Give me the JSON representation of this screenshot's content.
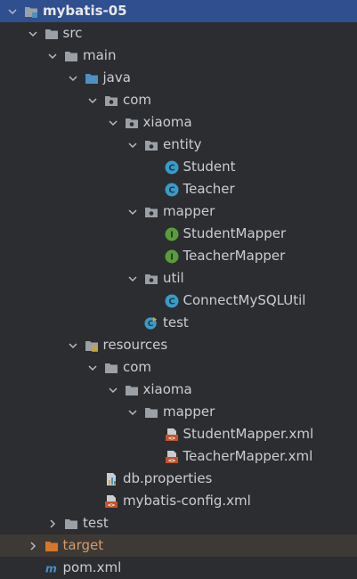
{
  "tree": [
    {
      "label": "mybatis-05",
      "kind": "module-folder",
      "icon": "module-folder-icon",
      "depth": 0,
      "expanded": true,
      "selected": true,
      "bold": true
    },
    {
      "label": "src",
      "kind": "folder",
      "icon": "folder-icon",
      "depth": 1,
      "expanded": true
    },
    {
      "label": "main",
      "kind": "folder",
      "icon": "folder-icon",
      "depth": 2,
      "expanded": true
    },
    {
      "label": "java",
      "kind": "source-folder",
      "icon": "source-root-folder-icon",
      "depth": 3,
      "expanded": true
    },
    {
      "label": "com",
      "kind": "package",
      "icon": "package-icon",
      "depth": 4,
      "expanded": true
    },
    {
      "label": "xiaoma",
      "kind": "package",
      "icon": "package-icon",
      "depth": 5,
      "expanded": true
    },
    {
      "label": "entity",
      "kind": "package",
      "icon": "package-icon",
      "depth": 6,
      "expanded": true
    },
    {
      "label": "Student",
      "kind": "class",
      "icon": "class-icon",
      "depth": 7
    },
    {
      "label": "Teacher",
      "kind": "class",
      "icon": "class-icon",
      "depth": 7
    },
    {
      "label": "mapper",
      "kind": "package",
      "icon": "package-icon",
      "depth": 6,
      "expanded": true
    },
    {
      "label": "StudentMapper",
      "kind": "interface",
      "icon": "interface-icon",
      "depth": 7
    },
    {
      "label": "TeacherMapper",
      "kind": "interface",
      "icon": "interface-icon",
      "depth": 7
    },
    {
      "label": "util",
      "kind": "package",
      "icon": "package-icon",
      "depth": 6,
      "expanded": true
    },
    {
      "label": "ConnectMySQLUtil",
      "kind": "class",
      "icon": "class-icon",
      "depth": 7
    },
    {
      "label": "test",
      "kind": "runnable-class",
      "icon": "runnable-class-icon",
      "depth": 6
    },
    {
      "label": "resources",
      "kind": "resources-folder",
      "icon": "resources-root-folder-icon",
      "depth": 3,
      "expanded": true
    },
    {
      "label": "com",
      "kind": "folder",
      "icon": "folder-icon",
      "depth": 4,
      "expanded": true
    },
    {
      "label": "xiaoma",
      "kind": "folder",
      "icon": "folder-icon",
      "depth": 5,
      "expanded": true
    },
    {
      "label": "mapper",
      "kind": "folder",
      "icon": "folder-icon",
      "depth": 6,
      "expanded": true
    },
    {
      "label": "StudentMapper.xml",
      "kind": "xml",
      "icon": "xml-file-icon",
      "depth": 7
    },
    {
      "label": "TeacherMapper.xml",
      "kind": "xml",
      "icon": "xml-file-icon",
      "depth": 7
    },
    {
      "label": "db.properties",
      "kind": "properties",
      "icon": "properties-file-icon",
      "depth": 4
    },
    {
      "label": "mybatis-config.xml",
      "kind": "xml",
      "icon": "xml-file-icon",
      "depth": 4
    },
    {
      "label": "test",
      "kind": "folder",
      "icon": "folder-icon",
      "depth": 2,
      "expanded": false
    },
    {
      "label": "target",
      "kind": "excluded-folder",
      "icon": "excluded-folder-icon",
      "depth": 1,
      "expanded": false,
      "excluded": true
    },
    {
      "label": "pom.xml",
      "kind": "maven",
      "icon": "maven-file-icon",
      "depth": 1
    }
  ],
  "colors": {
    "background": "#2b2d30",
    "selection": "#2f4f8f",
    "excluded_row": "#3d3a35",
    "folder": "#9aa0a6",
    "source_folder": "#4d90c2",
    "class_icon": "#3a9bc6",
    "interface_icon": "#5b9b3d",
    "xml_icon": "#c0542a",
    "excluded_folder": "#d6762a",
    "maven": "#4b8ec6"
  }
}
